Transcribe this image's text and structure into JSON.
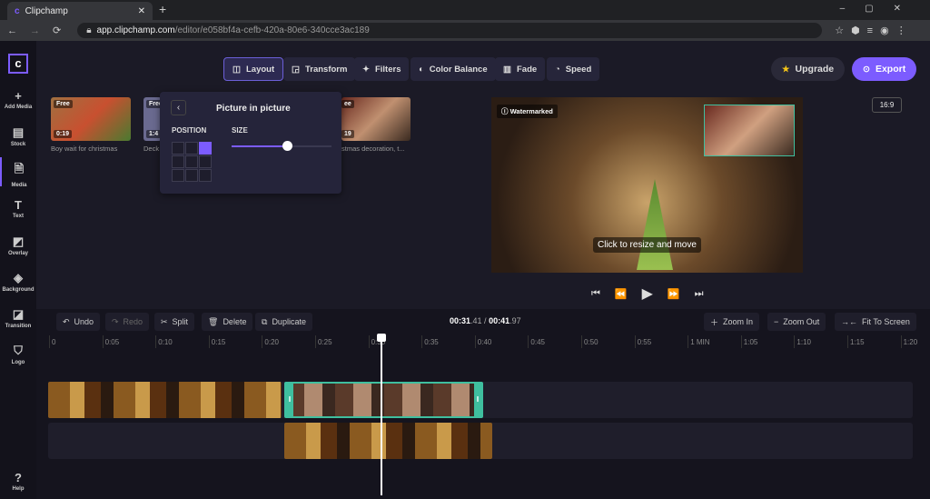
{
  "browser": {
    "tab_title": "Clipchamp",
    "url_host": "app.clipchamp.com",
    "url_path": "/editor/e058bf4a-cefb-420a-80e6-340cce3ac189"
  },
  "sidebar": {
    "items": [
      {
        "label": "Add Media",
        "icon": "+"
      },
      {
        "label": "Stock",
        "icon": "▤"
      },
      {
        "label": "Media",
        "icon": "🗎"
      },
      {
        "label": "Text",
        "icon": "T"
      },
      {
        "label": "Overlay",
        "icon": "◩"
      },
      {
        "label": "Background",
        "icon": "◈"
      },
      {
        "label": "Transition",
        "icon": "◪"
      },
      {
        "label": "Logo",
        "icon": "⛉"
      }
    ],
    "help": "Help"
  },
  "toolbar": {
    "layout": "Layout",
    "transform": "Transform",
    "filters": "Filters",
    "color_balance": "Color Balance",
    "fade": "Fade",
    "speed": "Speed",
    "upgrade": "Upgrade",
    "export": "Export",
    "aspect": "16:9"
  },
  "media": [
    {
      "badge": "Free",
      "duration": "0:19",
      "title": "Boy wait for christmas"
    },
    {
      "badge": "Free",
      "duration": "1:4",
      "title": "Deck"
    },
    {
      "badge": "ee",
      "duration": "19",
      "title": "stmas decoration, t..."
    }
  ],
  "pip": {
    "title": "Picture in picture",
    "position_label": "POSITION",
    "size_label": "SIZE",
    "size_value": 0.55,
    "selected_position": "top-right"
  },
  "preview": {
    "watermark": "Watermarked",
    "hint": "Click to resize and move"
  },
  "timeline": {
    "undo": "Undo",
    "redo": "Redo",
    "split": "Split",
    "delete": "Delete",
    "duplicate": "Duplicate",
    "time_current_main": "00:31",
    "time_current_frac": ".41",
    "time_sep": " / ",
    "time_total_main": "00:41",
    "time_total_frac": ".97",
    "zoom_in": "Zoom In",
    "zoom_out": "Zoom Out",
    "fit": "Fit To Screen",
    "ticks": [
      "0",
      "0:05",
      "0:10",
      "0:15",
      "0:20",
      "0:25",
      "0:30",
      "0:35",
      "0:40",
      "0:45",
      "0:50",
      "0:55",
      "1 MIN",
      "1:05",
      "1:10",
      "1:15",
      "1:20"
    ]
  },
  "colors": {
    "accent": "#7c5cff",
    "selected_clip": "#3fbf9f"
  }
}
